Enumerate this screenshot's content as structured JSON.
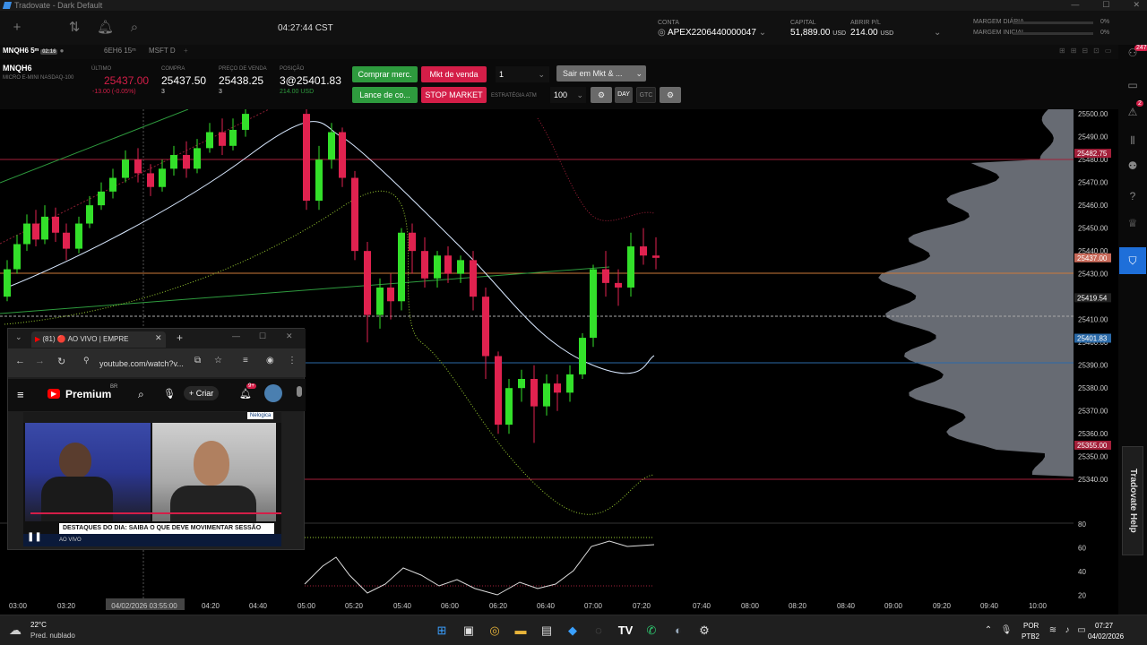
{
  "window": {
    "title": "Tradovate - Dark Default"
  },
  "topbar": {
    "clock": "04:27:44 CST",
    "account_label": "CONTA",
    "account_value": "APEX2206440000047",
    "capital_label": "CAPITAL",
    "capital_value": "51,889.00",
    "capital_unit": "USD",
    "pl_label": "ABRIR P/L",
    "pl_value": "214.00",
    "pl_unit": "USD",
    "margin_daily_label": "MARGEM DIÁRIA",
    "margin_daily_value": "0%",
    "margin_initial_label": "MARGEM INICIAL",
    "margin_initial_value": "0%"
  },
  "tabs": [
    {
      "label": "MNQH6 5ᵐ",
      "badge": "02:16",
      "active": true
    },
    {
      "label": "6EH6 15ᵐ",
      "active": false
    },
    {
      "label": "MSFT D",
      "active": false
    }
  ],
  "quote": {
    "symbol": "MNQH6",
    "description": "MICRO E-MINI NASDAQ-100",
    "last_label": "ÚLTIMO",
    "last_value": "25437.00",
    "last_change": "-13.00 (-0.05%)",
    "bid_label": "COMPRA",
    "bid_value": "25437.50",
    "bid_size": "3",
    "ask_label": "PREÇO DE VENDA",
    "ask_value": "25438.25",
    "ask_size": "3",
    "position_label": "POSIÇÃO",
    "position_value": "3@25401.83",
    "position_pl": "214.00 USD"
  },
  "order_buttons": {
    "buy_market": "Comprar merc.",
    "sell_market": "Mkt de venda",
    "qty": "1",
    "exit": "Sair em Mkt & ...",
    "bid": "Lance de co...",
    "stop_market": "STOP MARKET",
    "atm_label": "ESTRATÉGIA ATM",
    "atm_value": "100",
    "day": "DAY",
    "gtc": "GTC"
  },
  "chart_data": {
    "type": "candlestick",
    "ylim": [
      25335,
      25502
    ],
    "y_ticks": [
      "25500.00",
      "25490.00",
      "25480.00",
      "25470.00",
      "25460.00",
      "25450.00",
      "25440.00",
      "25430.00",
      "25420.00",
      "25410.00",
      "25400.00",
      "25390.00",
      "25380.00",
      "25370.00",
      "25360.00",
      "25350.00",
      "25340.00"
    ],
    "x_ticks": [
      "03:00",
      "03:20",
      "04/02/2026 03:55:00",
      "04:20",
      "04:40",
      "05:00",
      "05:20",
      "05:40",
      "06:00",
      "06:20",
      "06:40",
      "07:00",
      "07:20",
      "07:40",
      "08:00",
      "08:20",
      "08:40",
      "09:00",
      "09:20",
      "09:40",
      "10:00"
    ],
    "price_labels": [
      {
        "text": "25482.75",
        "kind": "red"
      },
      {
        "text": "25437.00",
        "kind": "last"
      },
      {
        "text": "25419.54",
        "kind": "gray"
      },
      {
        "text": "25401.83",
        "kind": "blue"
      },
      {
        "text": "25355.00",
        "kind": "red"
      }
    ],
    "osc_ticks": [
      "80",
      "60",
      "40",
      "20"
    ]
  },
  "browser": {
    "tab_title": "(81) 🔴 AO VIVO | EMPRE",
    "url": "youtube.com/watch?v...",
    "yt_brand": "Premium",
    "yt_region": "BR",
    "create": "Criar",
    "notif_count": "9+",
    "banner": "DESTAQUES DO DIA: SAIBA O QUE DEVE MOVIMENTAR SESSÃO",
    "live": "AO VIVO",
    "corner_logo": "Nelogica"
  },
  "rightbar": {
    "badge1": "247",
    "badge2": "2",
    "help": "Tradovate Help"
  },
  "taskbar": {
    "weather_temp": "22°C",
    "weather_desc": "Pred. nublado",
    "lang": "POR",
    "lang_sub": "PTB2",
    "time": "07:27",
    "date": "04/02/2026"
  }
}
